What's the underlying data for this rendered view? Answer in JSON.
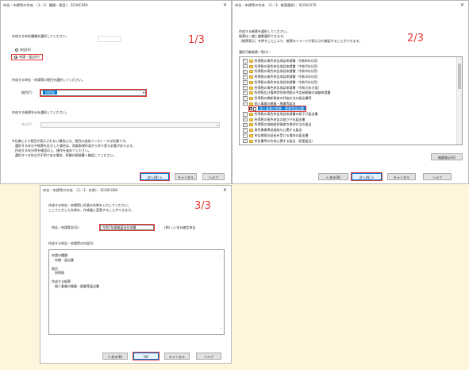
{
  "win1": {
    "title": "申告・申請等の作成　（1／3：種類・税目）：SC00C060",
    "step": "1/3",
    "q1": "作成する申告種類を選択してください。",
    "radio1": "申告(R)",
    "radio2": "申請・届出(A)",
    "q2": "作成する申告・申請等の税目を選択してください。",
    "tax_label": "税目(T)",
    "tax_value": "所得税",
    "q3": "作成する帳票年分を選択してください。",
    "year_label": "年分(Y)",
    "notes": [
      "※仕様により税目が表示されない場合には、税目の追加インストールが必要です。",
      "　選択する年分や帳票を区分した場合は、再度新規作成から作り直す必要があります。",
      "　作成する年分等を確認の上、操作を進めてください。",
      "　選択すべき年分が不明である場合、所轄の税務署へ確認してください。"
    ],
    "next": "次へ(N) >",
    "cancel": "キャンセル",
    "help": "ヘルプ"
  },
  "win2": {
    "title": "申告・申請等の作成　（2／3：帳票選択）：SC00C070",
    "step": "2/3",
    "intro": [
      "作成する帳票を選択してください。",
      "帳票は一度に複数選択できます。",
      "［帳票表示］を押すことにより、帳票のイメージが表示され確認することができます。"
    ],
    "list_label": "選択可能帳票一覧(L)：",
    "tree": [
      {
        "label": "所得税の青色申告承認申請書（令和6年分用）",
        "type": "folder",
        "indent": 0
      },
      {
        "label": "所得税の青色申告承認申請書（令和5年分用）",
        "type": "folder",
        "indent": 0
      },
      {
        "label": "所得税の青色申告承認申請書（令和4年分用）",
        "type": "folder",
        "indent": 0
      },
      {
        "label": "所得税の青色申告承認申請書（令和3年分用）",
        "type": "folder",
        "indent": 0
      },
      {
        "label": "所得税の青色申告承認申請書（令和2年分用）",
        "type": "folder",
        "indent": 0
      },
      {
        "label": "所得税の青色申告承認申請書（令和元年分用）",
        "type": "folder",
        "indent": 0
      },
      {
        "label": "所得税及び復興特別所得税の予定納税額の減額申請書",
        "type": "folder",
        "indent": 0
      },
      {
        "label": "所得税の棚卸資産の評価方法の届出書等",
        "type": "folder",
        "indent": 0
      },
      {
        "label": "個人事業の開業・廃業等届出",
        "type": "folder",
        "indent": 0
      },
      {
        "label": "個人事業の開業・廃業等届出書",
        "type": "doc",
        "indent": 1,
        "selected": true
      },
      {
        "label": "所得税の青色申告承認申請書の取下げ届出書",
        "type": "folder",
        "indent": 0
      },
      {
        "label": "所得税の青色申告の取りやめ届出書",
        "type": "folder",
        "indent": 0
      },
      {
        "label": "所得税の減価償却資産の償却方法の届出",
        "type": "folder",
        "indent": 0
      },
      {
        "label": "青色事業専従者給与に関する届出",
        "type": "folder",
        "indent": 0
      },
      {
        "label": "申告期限の延長を受ける場合の届出書",
        "type": "folder",
        "indent": 0
      },
      {
        "label": "申告書等の作成に関する届出（変更届出）",
        "type": "folder",
        "indent": 0
      }
    ],
    "show_btn": "帳票表示(V)",
    "back": "< 戻る(B)",
    "next": "次へ(N) >",
    "cancel": "キャンセル",
    "help": "ヘルプ"
  },
  "win3": {
    "title": "申告・申請等の作成　（3／3：名称）：SC00C080",
    "step": "3/3",
    "intro": [
      "作成する申告・申請等に任意の名称を入力してください。",
      "ここで入力した名称は、作成後に変更することができます。"
    ],
    "name_label": "申告・申請等名(S)：",
    "name_value": "令和7年開業届出作成書",
    "name_hint": "(例) ○○年分確定申告",
    "content_label": "作成する申告・申請等の内容(I)：",
    "content": [
      "申請の種類",
      "　申請・届出書",
      "",
      "税目",
      "　所得税",
      "",
      "作成する帳票",
      "　個人事業の開業・廃業等届出書"
    ],
    "back": "< 戻る(B)",
    "ok": "OK",
    "cancel": "キャンセル",
    "help": "ヘルプ"
  }
}
